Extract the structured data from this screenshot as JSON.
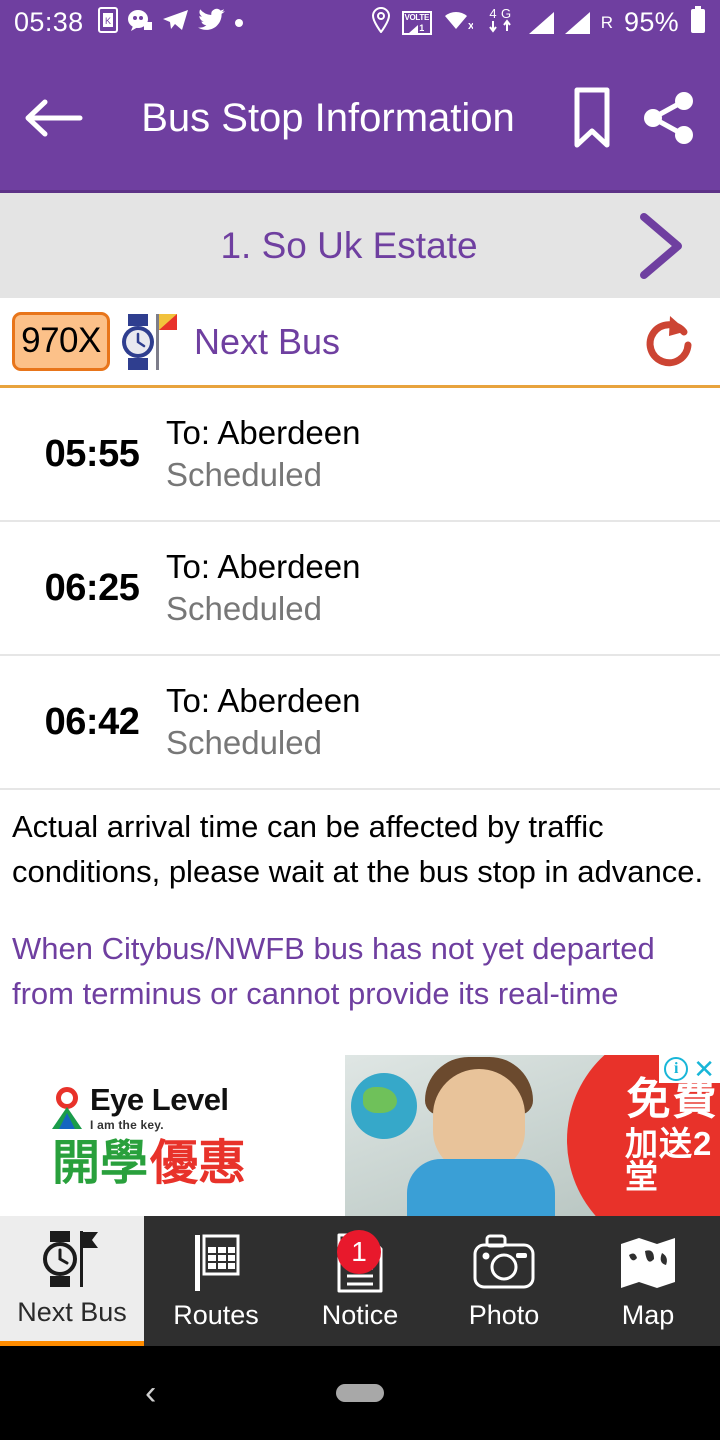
{
  "statusbar": {
    "time": "05:38",
    "battery": "95%",
    "roaming": "R",
    "network": "4G",
    "volte_label": "VOLTE",
    "volte_sim": "1",
    "icons": [
      "k-app-icon",
      "viber-icon",
      "telegram-icon",
      "twitter-icon",
      "dot-icon",
      "location-pin-icon",
      "volte-icon",
      "wifi-off-icon",
      "signal-icon",
      "battery-icon"
    ]
  },
  "appbar": {
    "title": "Bus Stop Information",
    "back_icon": "back-arrow-icon",
    "bookmark_icon": "bookmark-icon",
    "share_icon": "share-icon"
  },
  "stopbar": {
    "stop_name": "1. So Uk Estate",
    "next_icon": "chevron-right-icon"
  },
  "routebar": {
    "route_number": "970X",
    "label": "Next Bus",
    "refresh_icon": "refresh-icon",
    "badge_bg": "#fcc189",
    "badge_border": "#e8751a",
    "label_color": "#6f3fa0",
    "refresh_color": "#cc4433"
  },
  "arrivals": [
    {
      "time": "05:55",
      "destination": "To: Aberdeen",
      "status": "Scheduled"
    },
    {
      "time": "06:25",
      "destination": "To: Aberdeen",
      "status": "Scheduled"
    },
    {
      "time": "06:42",
      "destination": "To: Aberdeen",
      "status": "Scheduled"
    }
  ],
  "notices": {
    "primary": "Actual arrival time can be affected by traffic conditions, please wait at the bus stop in advance.",
    "secondary": "When Citybus/NWFB bus has not yet departed from terminus or cannot provide its real-time"
  },
  "ad": {
    "brand": "Eye Level",
    "tagline": "I am the key.",
    "headline_1": "開學",
    "headline_2": "優惠",
    "promo_1": "免費",
    "promo_2": "加送2堂",
    "info_icon": "ad-info-icon",
    "close_icon": "ad-close-icon",
    "close_label": "✕",
    "info_label": "i"
  },
  "tabs": [
    {
      "label": "Next Bus",
      "icon": "watch-flag-icon",
      "active": true,
      "badge": ""
    },
    {
      "label": "Routes",
      "icon": "timetable-icon",
      "active": false,
      "badge": ""
    },
    {
      "label": "Notice",
      "icon": "document-icon",
      "active": false,
      "badge": "1"
    },
    {
      "label": "Photo",
      "icon": "camera-icon",
      "active": false,
      "badge": ""
    },
    {
      "label": "Map",
      "icon": "map-icon",
      "active": false,
      "badge": ""
    }
  ],
  "navbar": {
    "back_icon": "system-back-icon",
    "back_glyph": "‹",
    "home_icon": "system-home-pill"
  },
  "colors": {
    "purple": "#6f3fa0",
    "orange_accent": "#ff8c00",
    "stopbar_bg": "#e4e4e4",
    "tabbar_bg": "#2f2f2f",
    "badge_red": "#e8192c"
  }
}
